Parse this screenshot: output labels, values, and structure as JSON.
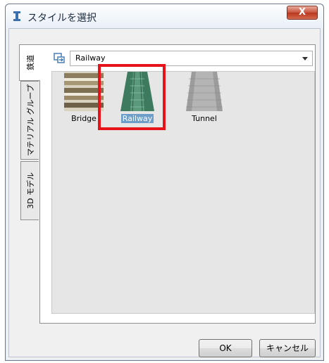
{
  "window": {
    "title": "スタイルを選択",
    "close_label": "X"
  },
  "tabs": [
    {
      "label": "鉄道",
      "active": true
    },
    {
      "label": "マテリアル グループ",
      "active": false
    },
    {
      "label": "3D モデル",
      "active": false
    }
  ],
  "panel": {
    "category_select": {
      "value": "Railway"
    },
    "styles": [
      {
        "name": "Bridge",
        "icon": "bridge-texture"
      },
      {
        "name": "Railway",
        "icon": "railway-texture",
        "selected": true
      },
      {
        "name": "Tunnel",
        "icon": "tunnel-texture"
      }
    ]
  },
  "buttons": {
    "ok": "OK",
    "cancel": "キャンセル"
  },
  "colors": {
    "highlight": "#e8131a",
    "selection": "#6d9ec9",
    "close_button": "#c8533d"
  }
}
